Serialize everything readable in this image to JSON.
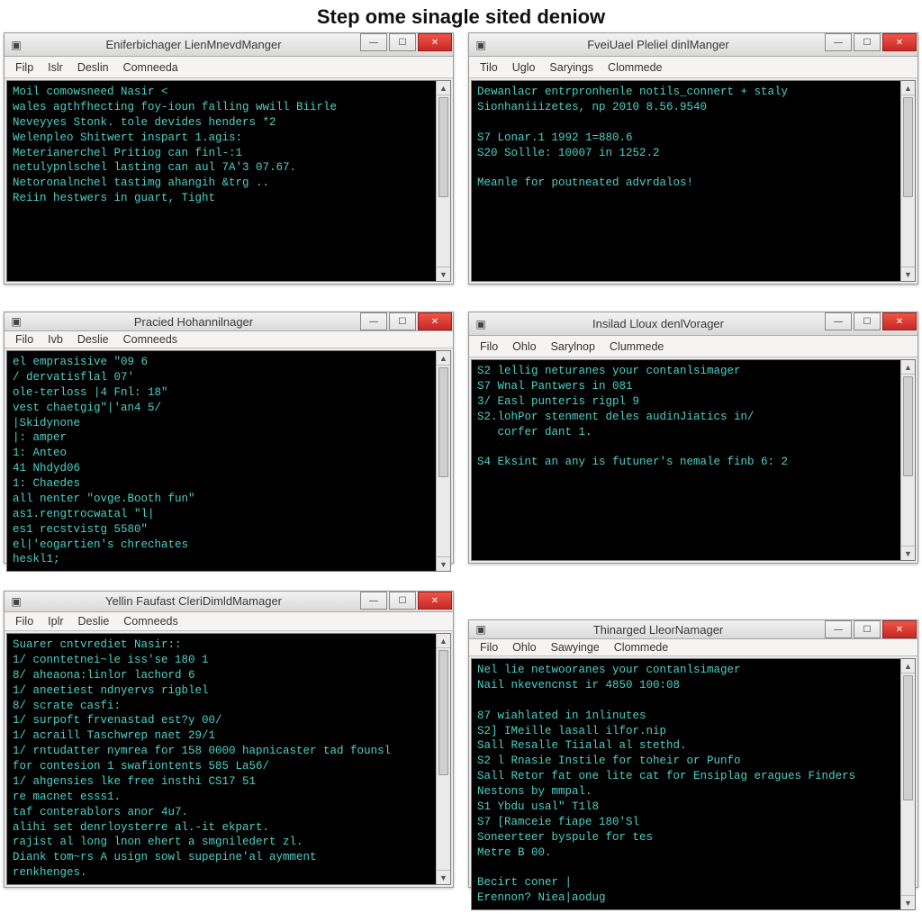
{
  "page_heading": "Step ome sinagle sited deniow",
  "colors": {
    "terminal_fg": "#4fd0c7",
    "terminal_bg": "#000000",
    "close_btn": "#c62828"
  },
  "windows": [
    {
      "id": "w0",
      "title": "Eniferbichager LienMnevdManger",
      "menus": [
        "Filp",
        "Islr",
        "Deslin",
        "Comneeda"
      ],
      "lines": [
        "Moil comowsneed Nasir <",
        "wales agthfhecting foy-ioun falling wwill Biirle",
        "Neveyyes Stonk. tole devides henders *2",
        "Welenpleo Shitwert inspart 1.agis:",
        "Meterianerchel Pritiog can finl-:1",
        "netulypnlschel lasting can aul 7A'3 07.67.",
        "Netoronalnchel tastimg ahangih &trg ..",
        "Reiin hestwers in guart, Tight"
      ]
    },
    {
      "id": "w1",
      "title": "FveiUael Pleliel dinlManger",
      "menus": [
        "Tilo",
        "Uglo",
        "Saryings",
        "Clommede"
      ],
      "lines": [
        "Dewanlacr entrpronhenle notils_connert + staly",
        "Sionhaniiizetes, np 2010 8.56.9540",
        "",
        "S7 Lonar.1 1992 1=880.6",
        "S20 Sollle: 10007 in 1252.2",
        "",
        "Meanle for poutneated advrdalos!"
      ]
    },
    {
      "id": "w2",
      "title": "Pracied Hohannilnager",
      "menus": [
        "Filo",
        "Ivb",
        "Deslie",
        "Comneeds"
      ],
      "lines": [
        "el emprasisive \"09 6",
        "/ dervatisflal 07'",
        "ole-terloss |4 Fnl: 18\"",
        "vest chaetgig\"|'an4 5/",
        "|Skidynone",
        "|: amper",
        "1: Anteo",
        "41 Nhdyd06",
        "1: Chaedes",
        "all nenter \"ovge.Booth fun\"",
        "as1.rengtrocwatal \"l|",
        "es1 recstvistg 5580\"",
        "el|'eogartien's chrechates",
        "heskl1;"
      ]
    },
    {
      "id": "w3",
      "title": "Insilad Lloux denlVorager",
      "menus": [
        "Filo",
        "Ohlo",
        "Sarylnop",
        "Clummede"
      ],
      "lines": [
        "S2 lellig neturanes your contanlsimager",
        "S7 Wnal Pantwers in 081",
        "3/ Easl punteris rigpl 9",
        "S2.lohPor stenment deles audinJiatics in/",
        "   corfer dant 1.",
        "",
        "S4 Eksint an any is futuner's nemale finb 6: 2"
      ]
    },
    {
      "id": "w4",
      "title": "Yellin Faufast CleriDimldMamager",
      "menus": [
        "Filo",
        "Iplr",
        "Deslie",
        "Comneeds"
      ],
      "lines": [
        "Suarer cntvrediet Nasir::",
        "1/ conntetnei~le iss'se 180 1",
        "8/ aheaona:linlor lachord 6",
        "1/ aneetiest ndnyervs rigblel",
        "8/ scrate casfi:",
        "1/ surpoft frvenastad est?y 00/",
        "1/ acraill Taschwrep naet 29/1",
        "1/ rntudatter nymrea for 158 0000 hapnicaster tad founsl",
        "for contesion 1 swafiontents 585 La56/",
        "1/ ahgensies lke free insthi CS17 51",
        "re macnet esss1.",
        "taf conterablors anor 4u7.",
        "alihi set denrloysterre al.-it ekpart.",
        "rajist al long lnon ehert a smgniledert zl.",
        "Diank tom~rs A usign sowl supepine'al aymment",
        "renkhenges."
      ]
    },
    {
      "id": "w5",
      "title": "Thinarged LleorNamager",
      "menus": [
        "Filo",
        "Ohlo",
        "Sawyinge",
        "Clommede"
      ],
      "offset": true,
      "lines": [
        "Nel lie netwooranes your contanlsimager",
        "Nail nkevencnst ir 4850 100:08",
        "",
        "87 wiahlated in 1nlinutes",
        "S2] IMeille lasall ilfor.nip",
        "Sall Resalle Tiialal al stethd.",
        "S2 l Rnasie Instile for toheir or Punfo",
        "Sall Retor fat one lite cat for Ensiplag eragues Finders",
        "Nestons by mmpal.",
        "S1 Ybdu usal\" T1l8",
        "S7 [Ramceie fiape 180'Sl",
        "Soneerteer byspule for tes",
        "Metre B 00.",
        "",
        "Becirt coner |",
        "Erennon? Niea|aodug"
      ]
    }
  ]
}
